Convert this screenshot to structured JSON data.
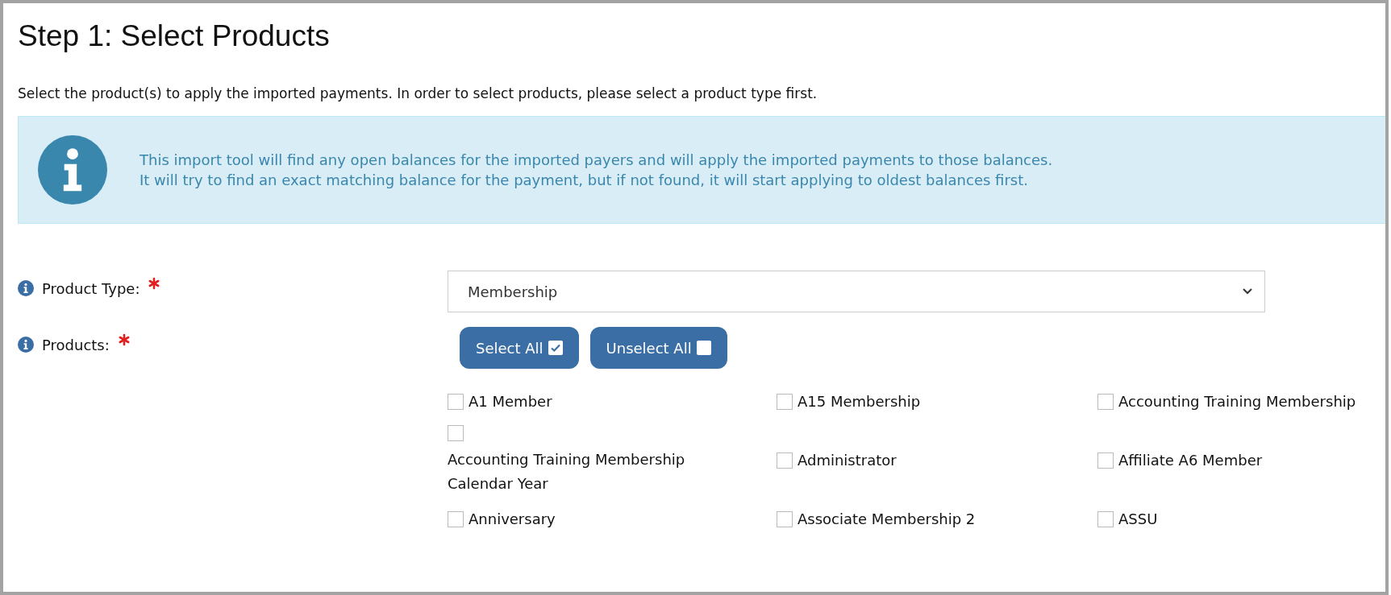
{
  "title": "Step 1: Select Products",
  "description": "Select the product(s) to apply the imported payments. In order to select products, please select a product type first.",
  "alert": {
    "lines": [
      "This import tool will find any open balances for the imported payers and will apply the imported payments to those balances.",
      "It will try to find an exact matching balance for the payment, but if not found, it will start applying to oldest balances first."
    ]
  },
  "fields": [
    {
      "label": "Product Type:",
      "required": true,
      "kind": "select",
      "value": "Membership"
    },
    {
      "label": "Products:",
      "required": true,
      "kind": "checklist",
      "buttons": [
        {
          "label": "Select All",
          "kind": "select-all"
        },
        {
          "label": "Unselect All",
          "kind": "unselect-all"
        }
      ],
      "items": [
        {
          "label": "A1 Member",
          "checked": false
        },
        {
          "label": "A15 Membership",
          "checked": false
        },
        {
          "label": "Accounting Training Membership",
          "checked": false
        },
        {
          "label": "Accounting Training Membership Calendar Year",
          "checked": false
        },
        {
          "label": "Administrator",
          "checked": false
        },
        {
          "label": "Affiliate A6 Member",
          "checked": false
        },
        {
          "label": "Anniversary",
          "checked": false
        },
        {
          "label": "Associate Membership 2",
          "checked": false
        },
        {
          "label": "ASSU",
          "checked": false
        }
      ]
    }
  ]
}
